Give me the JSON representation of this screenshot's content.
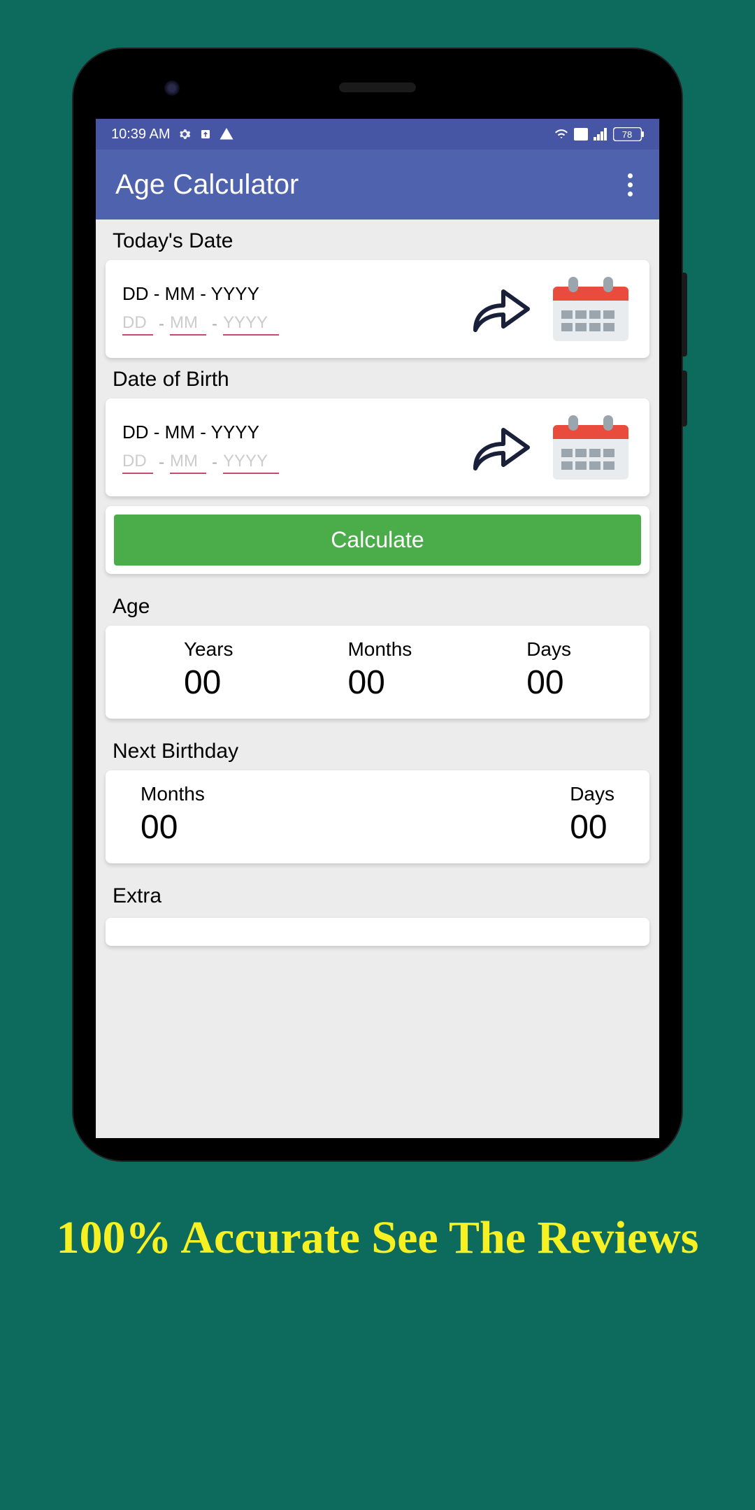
{
  "statusBar": {
    "time": "10:39 AM",
    "battery": "78"
  },
  "appBar": {
    "title": "Age Calculator"
  },
  "sections": {
    "today": {
      "title": "Today's Date",
      "format": "DD - MM - YYYY",
      "placeholders": {
        "dd": "DD",
        "mm": "MM",
        "yyyy": "YYYY"
      }
    },
    "dob": {
      "title": "Date of Birth",
      "format": "DD - MM - YYYY",
      "placeholders": {
        "dd": "DD",
        "mm": "MM",
        "yyyy": "YYYY"
      }
    }
  },
  "buttons": {
    "calculate": "Calculate"
  },
  "age": {
    "title": "Age",
    "labels": {
      "years": "Years",
      "months": "Months",
      "days": "Days"
    },
    "values": {
      "years": "00",
      "months": "00",
      "days": "00"
    }
  },
  "nextBirthday": {
    "title": "Next Birthday",
    "labels": {
      "months": "Months",
      "days": "Days"
    },
    "values": {
      "months": "00",
      "days": "00"
    }
  },
  "extra": {
    "title": "Extra"
  },
  "tagline": "100% Accurate See The Reviews"
}
